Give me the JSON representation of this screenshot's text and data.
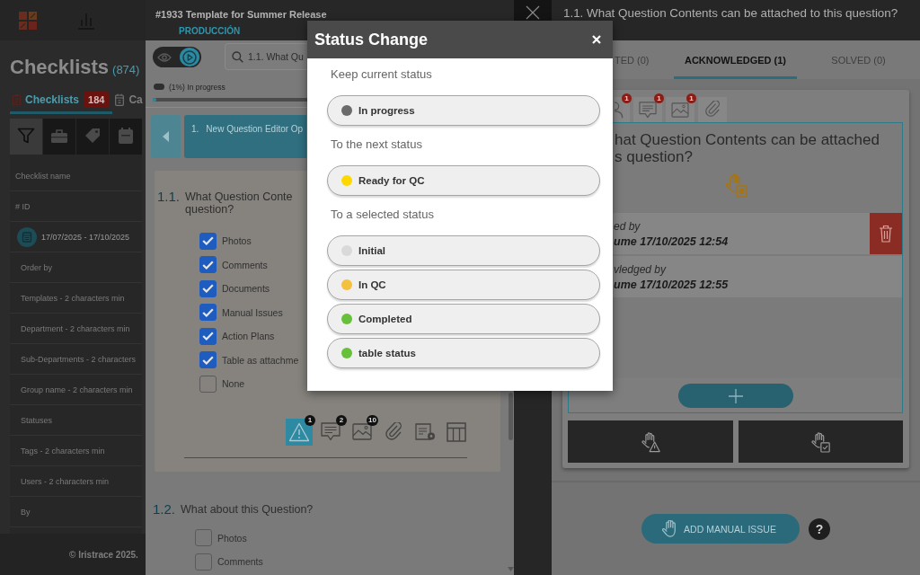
{
  "checklists_page": {
    "title": "Checklists",
    "count": "(874)",
    "tabs": [
      {
        "label": "Checklists",
        "badge": "184",
        "selected": true
      },
      {
        "label": "Ca",
        "selected": false
      }
    ],
    "filter_tabs": [
      {
        "selected": true
      },
      {
        "selected": false
      },
      {
        "selected": false
      },
      {
        "selected": false
      }
    ],
    "filters": [
      {
        "kind": "text",
        "placeholder": "Checklist name"
      },
      {
        "kind": "text",
        "placeholder": "# ID"
      },
      {
        "kind": "date",
        "value": "17/07/2025 - 17/10/2025"
      },
      {
        "kind": "select",
        "placeholder": "Order by"
      },
      {
        "kind": "select",
        "placeholder": "Templates - 2 characters min"
      },
      {
        "kind": "select",
        "placeholder": "Department - 2 characters min"
      },
      {
        "kind": "select",
        "placeholder": "Sub-Departments - 2 characters"
      },
      {
        "kind": "select",
        "placeholder": "Group name - 2 characters min"
      },
      {
        "kind": "select",
        "placeholder": "Statuses"
      },
      {
        "kind": "select",
        "placeholder": "Tags - 2 characters min"
      },
      {
        "kind": "select",
        "placeholder": "Users - 2 characters min"
      },
      {
        "kind": "select",
        "placeholder": "By"
      }
    ],
    "footer": "© Iristrace 2025."
  },
  "checklist_drawer": {
    "title": "#1933 Template for Summer Release",
    "subtitle": "PRODUCCIÓN",
    "mode_toggle": [
      {
        "selected": false
      },
      {
        "selected": true
      }
    ],
    "search": {
      "value": "1.1. What Qu"
    },
    "progress": {
      "label": "(1%) In progress",
      "level": 0.01
    },
    "section": {
      "number": "1.",
      "title": "New Question Editor Op"
    },
    "questions": [
      {
        "number": "1.1.",
        "text": "What Question Conte question?",
        "selected": true,
        "options": [
          {
            "label": "Photos",
            "checked": true
          },
          {
            "label": "Comments",
            "checked": true
          },
          {
            "label": "Documents",
            "checked": true
          },
          {
            "label": "Manual Issues",
            "checked": true
          },
          {
            "label": "Action Plans",
            "checked": true
          },
          {
            "label": "Table as attachme",
            "checked": true
          },
          {
            "label": "None",
            "checked": false
          }
        ],
        "tools": [
          {
            "badge": "1",
            "selected": true
          },
          {
            "badge": "2",
            "selected": false
          },
          {
            "badge": "10",
            "selected": false
          },
          {
            "selected": false
          },
          {
            "selected": false
          },
          {
            "selected": false
          }
        ]
      },
      {
        "number": "1.2.",
        "text": "What about this Question?",
        "selected": false,
        "options": [
          {
            "label": "Photos",
            "checked": false
          },
          {
            "label": "Comments",
            "checked": false
          }
        ]
      }
    ]
  },
  "issue_panel": {
    "title": "1.1. What Question Contents can be attached to this question?",
    "tabs": [
      {
        "label": "TED (0)",
        "selected": false
      },
      {
        "label": "ACKNOWLEDGED (1)",
        "selected": true
      },
      {
        "label": "SOLVED (0)",
        "selected": false
      }
    ],
    "content_tabs": [
      {
        "badge": "1"
      },
      {
        "badge": "1"
      },
      {
        "badge": "1"
      }
    ],
    "question": "hat Question Contents can be attached s question?",
    "log": [
      {
        "label": "ed by",
        "value": "ume 17/10/2025 12:54",
        "deletable": true
      },
      {
        "label": "vledged by",
        "value": "ume 17/10/2025 12:55",
        "deletable": false
      }
    ],
    "add_button": "ADD MANUAL ISSUE",
    "help": "?"
  },
  "status_modal": {
    "title": "Status Change",
    "sections": [
      {
        "heading": "Keep current status",
        "statuses": [
          {
            "label": "In progress",
            "color": "#6b6b6b"
          }
        ]
      },
      {
        "heading": "To the next status",
        "statuses": [
          {
            "label": "Ready for QC",
            "color": "#ffd800"
          }
        ]
      },
      {
        "heading": "To a selected status",
        "statuses": [
          {
            "label": "Initial",
            "color": "#d9d9d9"
          },
          {
            "label": "In QC",
            "color": "#f5c03e"
          },
          {
            "label": "Completed",
            "color": "#66c03a"
          },
          {
            "label": "table status",
            "color": "#66c03a"
          }
        ]
      }
    ]
  }
}
